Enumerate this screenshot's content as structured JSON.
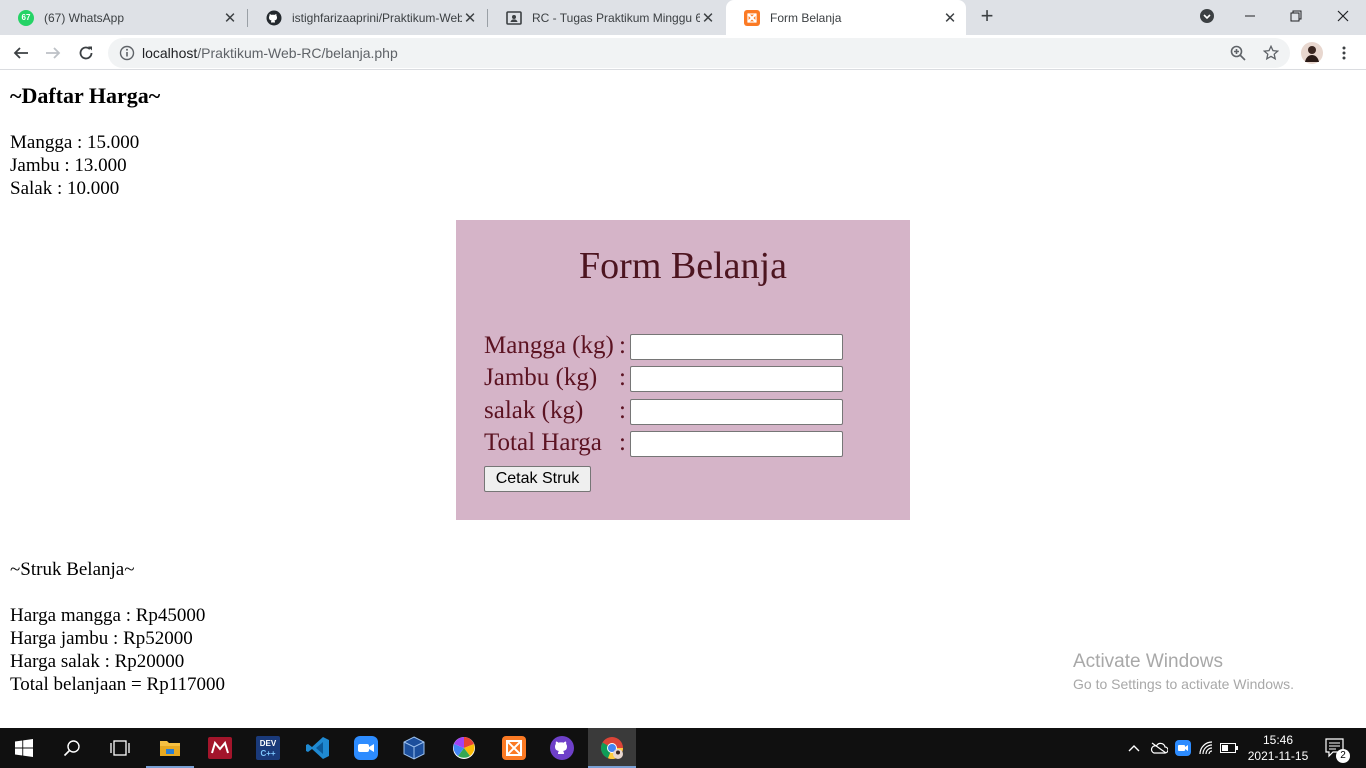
{
  "browser": {
    "tabs": [
      {
        "title": "(67) WhatsApp",
        "badge": "67",
        "icon": "whatsapp-icon"
      },
      {
        "title": "istighfarizaaprini/Praktikum-Web",
        "icon": "github-icon"
      },
      {
        "title": "RC - Tugas Praktikum Minggu 6",
        "icon": "classroom-icon"
      },
      {
        "title": "Form Belanja",
        "icon": "xampp-icon",
        "active": true
      }
    ],
    "address": {
      "host": "localhost",
      "path": "/Praktikum-Web-RC/belanja.php"
    }
  },
  "page": {
    "heading": "~Daftar Harga~",
    "prices": [
      "Mangga : 15.000",
      "Jambu : 13.000",
      "Salak : 10.000"
    ],
    "form": {
      "title": "Form Belanja",
      "fields": [
        {
          "label": "Mangga (kg)",
          "colon": ":",
          "value": ""
        },
        {
          "label": "Jambu (kg)",
          "colon": ":",
          "value": ""
        },
        {
          "label": "salak (kg)",
          "colon": ":",
          "value": ""
        },
        {
          "label": "Total Harga",
          "colon": ":",
          "value": ""
        }
      ],
      "submit_label": "Cetak Struk",
      "background": "#d5b4c8",
      "text_color": "#5c1322"
    },
    "receipt": {
      "title": "~Struk Belanja~",
      "lines": [
        "Harga mangga : Rp45000",
        "Harga jambu : Rp52000",
        "Harga salak : Rp20000",
        "Total belanjaan = Rp117000"
      ]
    }
  },
  "watermark": {
    "line1": "Activate Windows",
    "line2": "Go to Settings to activate Windows."
  },
  "taskbar": {
    "apps": [
      "start-icon",
      "search-icon",
      "task-view-icon",
      "file-explorer-icon",
      "mendeley-icon",
      "dev-cpp-icon",
      "vscode-icon",
      "zoom-icon",
      "virtualbox-icon",
      "photos-icon",
      "xampp-icon",
      "github-desktop-icon",
      "chrome-icon"
    ],
    "time": "15:46",
    "date": "2021-11-15",
    "notification_count": "2"
  }
}
